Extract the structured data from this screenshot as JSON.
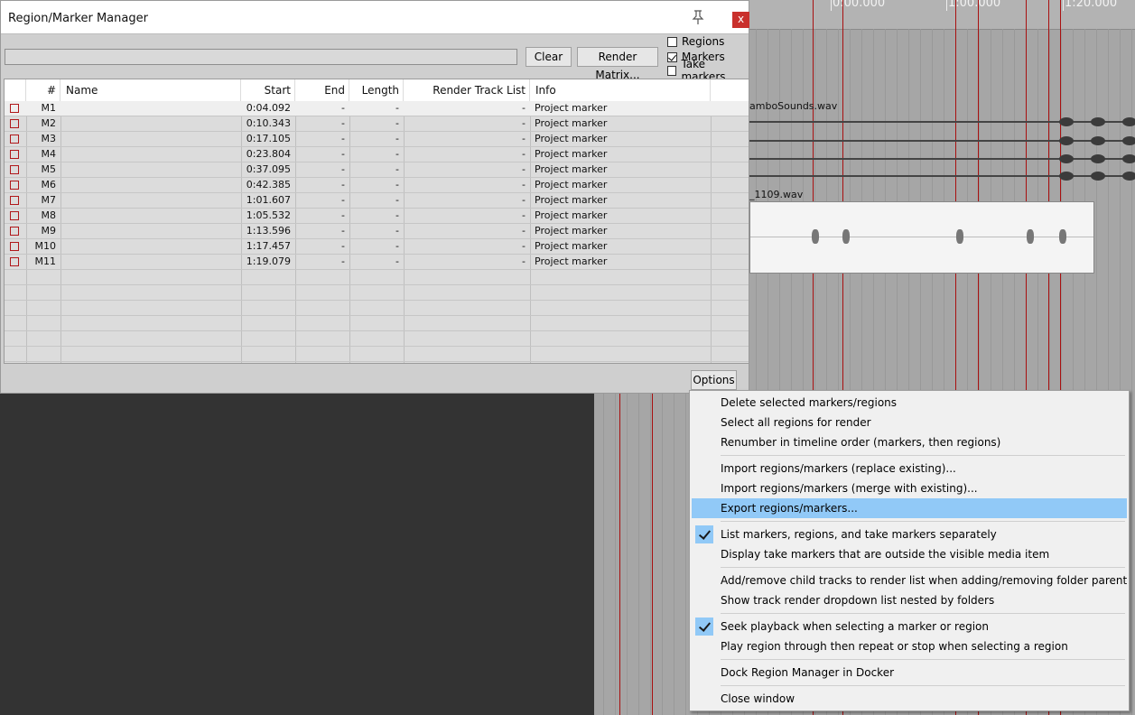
{
  "window": {
    "title": "Region/Marker Manager",
    "close_label": "x"
  },
  "toolbar": {
    "filter_value": "",
    "clear_label": "Clear",
    "render_matrix_label": "Render Matrix...",
    "options_label": "Options"
  },
  "checkboxes": [
    {
      "label": "Regions",
      "checked": false
    },
    {
      "label": "Markers",
      "checked": true
    },
    {
      "label": "Take markers",
      "checked": false
    }
  ],
  "table": {
    "columns": [
      "#",
      "Name",
      "Start",
      "End",
      "Length",
      "Render Track List",
      "Info"
    ],
    "rows": [
      {
        "id": "M1",
        "name": "",
        "start": "0:04.092",
        "end": "-",
        "length": "-",
        "render": "-",
        "info": "Project marker"
      },
      {
        "id": "M2",
        "name": "",
        "start": "0:10.343",
        "end": "-",
        "length": "-",
        "render": "-",
        "info": "Project marker"
      },
      {
        "id": "M3",
        "name": "",
        "start": "0:17.105",
        "end": "-",
        "length": "-",
        "render": "-",
        "info": "Project marker"
      },
      {
        "id": "M4",
        "name": "",
        "start": "0:23.804",
        "end": "-",
        "length": "-",
        "render": "-",
        "info": "Project marker"
      },
      {
        "id": "M5",
        "name": "",
        "start": "0:37.095",
        "end": "-",
        "length": "-",
        "render": "-",
        "info": "Project marker"
      },
      {
        "id": "M6",
        "name": "",
        "start": "0:42.385",
        "end": "-",
        "length": "-",
        "render": "-",
        "info": "Project marker"
      },
      {
        "id": "M7",
        "name": "",
        "start": "1:01.607",
        "end": "-",
        "length": "-",
        "render": "-",
        "info": "Project marker"
      },
      {
        "id": "M8",
        "name": "",
        "start": "1:05.532",
        "end": "-",
        "length": "-",
        "render": "-",
        "info": "Project marker"
      },
      {
        "id": "M9",
        "name": "",
        "start": "1:13.596",
        "end": "-",
        "length": "-",
        "render": "-",
        "info": "Project marker"
      },
      {
        "id": "M10",
        "name": "",
        "start": "1:17.457",
        "end": "-",
        "length": "-",
        "render": "-",
        "info": "Project marker"
      },
      {
        "id": "M11",
        "name": "",
        "start": "1:19.079",
        "end": "-",
        "length": "-",
        "render": "-",
        "info": "Project marker"
      }
    ]
  },
  "timeline": {
    "ruler_labels": [
      "0:00.000",
      "1:00.000",
      "1:20.000"
    ],
    "track1_name": "amboSounds.wav",
    "track2_name": "_1109.wav"
  },
  "context_menu": {
    "items": [
      {
        "label": "Delete selected markers/regions",
        "checked": false,
        "highlighted": false
      },
      {
        "label": "Select all regions for render",
        "checked": false,
        "highlighted": false
      },
      {
        "label": "Renumber in timeline order (markers, then regions)",
        "checked": false,
        "highlighted": false
      },
      {
        "label": "Import regions/markers (replace existing)...",
        "checked": false,
        "highlighted": false
      },
      {
        "label": "Import regions/markers (merge with existing)...",
        "checked": false,
        "highlighted": false
      },
      {
        "label": "Export regions/markers...",
        "checked": false,
        "highlighted": true
      },
      {
        "label": "List markers, regions, and take markers separately",
        "checked": true,
        "highlighted": false
      },
      {
        "label": "Display take markers that are outside the visible media item",
        "checked": false,
        "highlighted": false
      },
      {
        "label": "Add/remove child tracks to render list when adding/removing folder parent",
        "checked": false,
        "highlighted": false
      },
      {
        "label": "Show track render dropdown list nested by folders",
        "checked": false,
        "highlighted": false
      },
      {
        "label": "Seek playback when selecting a marker or region",
        "checked": true,
        "highlighted": false
      },
      {
        "label": "Play region through then repeat or stop when selecting a region",
        "checked": false,
        "highlighted": false
      },
      {
        "label": "Dock Region Manager in Docker",
        "checked": false,
        "highlighted": false
      },
      {
        "label": "Close window",
        "checked": false,
        "highlighted": false
      }
    ]
  },
  "colors": {
    "marker": "#a81010",
    "highlight": "#91c9f7",
    "close": "#c9302c"
  }
}
